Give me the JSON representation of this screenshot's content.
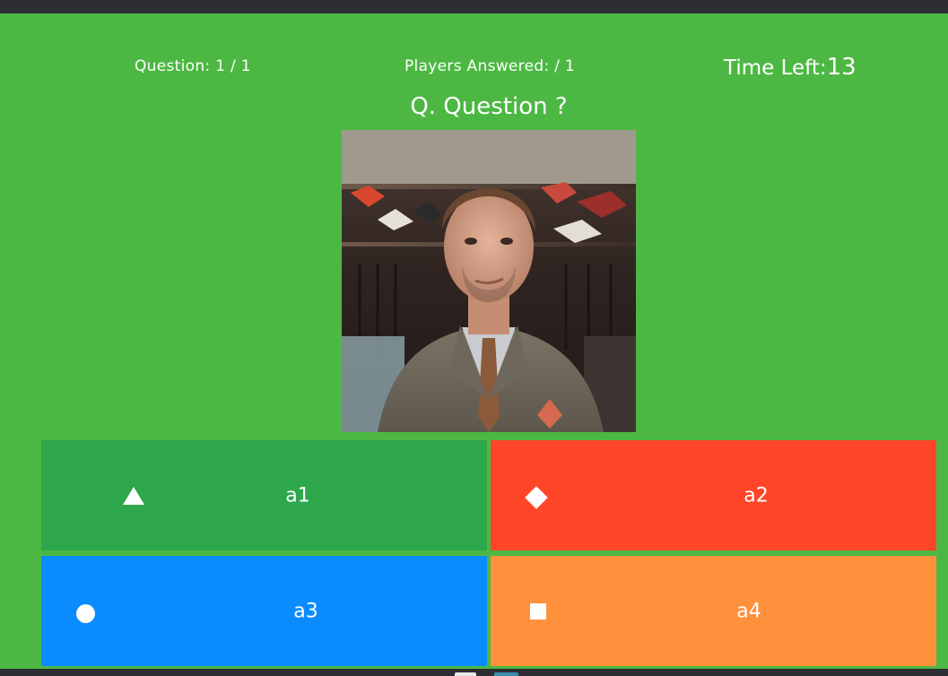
{
  "header": {
    "question_counter": "Question: 1 / 1",
    "players_answered": "Players Answered: / 1",
    "time_left_label": "Time Left:",
    "time_left_value": "13"
  },
  "question": {
    "title": "Q. Question ?"
  },
  "answers": [
    {
      "label": "a1",
      "shape_icon": "triangle-icon",
      "color": "#2ea64c"
    },
    {
      "label": "a2",
      "shape_icon": "diamond-icon",
      "color": "#ff4629"
    },
    {
      "label": "a3",
      "shape_icon": "circle-icon",
      "color": "#0a8cff"
    },
    {
      "label": "a4",
      "shape_icon": "square-icon",
      "color": "#ff913c"
    }
  ],
  "colors": {
    "background": "#4cb843",
    "chrome": "#2d2e33"
  }
}
